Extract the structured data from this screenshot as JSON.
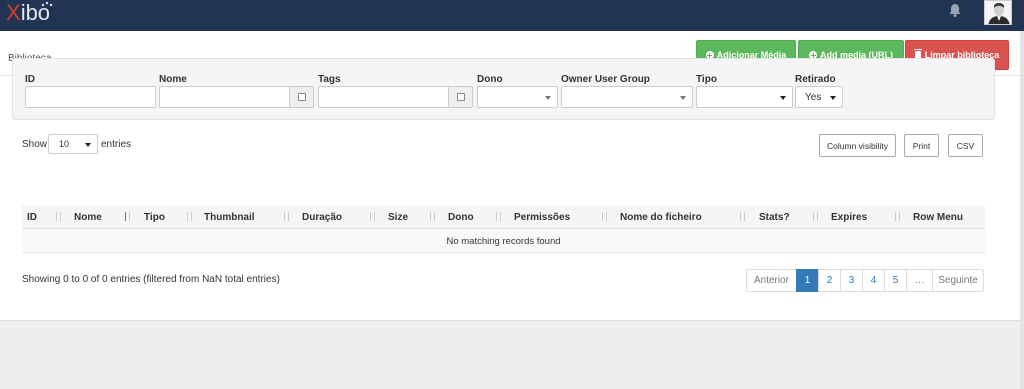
{
  "brand": {
    "logo_text": "Xibo",
    "logo_x": "X",
    "logo_rest": "ibo"
  },
  "header": {
    "page_title": "Biblioteca",
    "buttons": {
      "add_media": "Adicionar Média",
      "add_media_url": "Add media (URL)",
      "clear_library": "Limpar biblioteca"
    }
  },
  "filters": {
    "id_label": "ID",
    "name_label": "Nome",
    "tags_label": "Tags",
    "owner_label": "Dono",
    "owner_group_label": "Owner User Group",
    "type_label": "Tipo",
    "retired_label": "Retirado",
    "retired_value": "Yes"
  },
  "table_controls": {
    "show_label": "Show",
    "length_value": "10",
    "entries_label": "entries",
    "column_visibility": "Column visibility",
    "print": "Print",
    "csv": "CSV"
  },
  "table": {
    "columns": [
      "ID",
      "Nome",
      "Tipo",
      "Thumbnail",
      "Duração",
      "Size",
      "Dono",
      "Permissões",
      "Nome do ficheiro",
      "Stats?",
      "Expires",
      "Row Menu"
    ],
    "empty_message": "No matching records found"
  },
  "info_text": "Showing 0 to 0 of 0 entries (filtered from NaN total entries)",
  "pagination": {
    "previous": "Anterior",
    "pages": [
      "1",
      "2",
      "3",
      "4",
      "5"
    ],
    "ellipsis": "…",
    "next": "Seguinte",
    "current_page": "1"
  },
  "colors": {
    "nav": "#223453",
    "success": "#5cb85c",
    "danger": "#d9534f",
    "primary": "#337ab7"
  },
  "icons": [
    "bell-icon",
    "user-avatar-icon",
    "plus-circle-icon",
    "trash-icon",
    "sort-icon"
  ]
}
